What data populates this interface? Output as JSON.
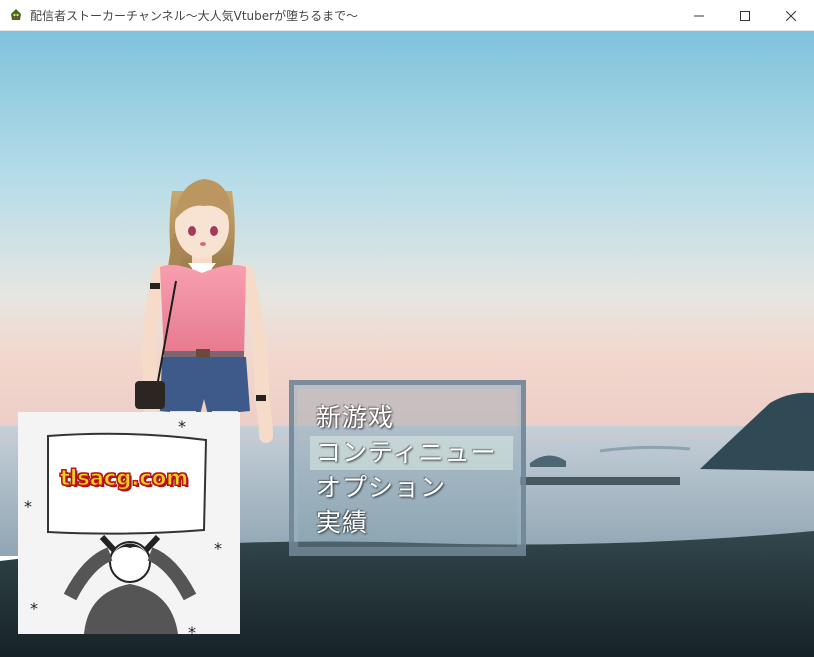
{
  "window": {
    "title": "配信者ストーカーチャンネル～大人気Vtuberが堕ちるまで～",
    "controls": [
      "minimize-icon",
      "maximize-icon",
      "close-icon"
    ]
  },
  "menu": {
    "items": [
      {
        "label": "新游戏",
        "selected": false
      },
      {
        "label": "コンティニュー",
        "selected": true
      },
      {
        "label": "オプション",
        "selected": false
      },
      {
        "label": "実績",
        "selected": false
      }
    ]
  },
  "watermark": {
    "text": "tlsacg.com"
  },
  "colors": {
    "sky_top": "#8fcbe0",
    "sky_horizon": "#f3d8cc",
    "sea": "#aabccc",
    "beach": "#1f2f33",
    "menu_border": "#6e8296",
    "menu_text": "#ffffff"
  }
}
